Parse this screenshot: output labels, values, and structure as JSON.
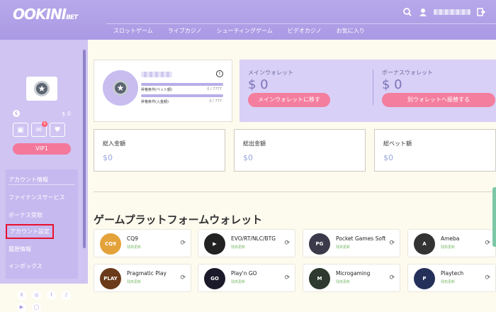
{
  "header": {
    "logo": "OOKINI",
    "logo_sub": "BET",
    "nav": [
      "スロットゲーム",
      "ライブカジノ",
      "シューティングゲーム",
      "ビデオカジノ",
      "お気に入り"
    ]
  },
  "sidebar": {
    "balance": "$ 0",
    "vip": "VIP1",
    "gift_badge": "0",
    "menu_title": "アカウント情報",
    "items": [
      "ファイナンスサービス",
      "ボーナス受取",
      "アカウント設定",
      "履歴情報",
      "インボックス"
    ]
  },
  "profile": {
    "bar1_label": "昇格条件(ベット額)",
    "bar1_value": "0 / 7777",
    "bar2_label": "昇格条件(入金額)",
    "bar2_value": "0 / 777"
  },
  "wallet": {
    "main_label": "メインウォレット",
    "main_value": "$ 0",
    "main_button": "メインウォレットに移す",
    "bonus_label": "ボーナスウォレット",
    "bonus_value": "$ 0",
    "bonus_button": "別ウォレットへ振替する"
  },
  "stats": [
    {
      "label": "総入金額",
      "value": "$0"
    },
    {
      "label": "総出金額",
      "value": "$0"
    },
    {
      "label": "総ベット額",
      "value": "$0"
    }
  ],
  "section_title": "ゲームプラットフォームウォレット",
  "games": [
    {
      "name": "CQ9",
      "status": "残高更新",
      "icon": "CQ9",
      "color": "#e4a23a"
    },
    {
      "name": "EVO/RT/NLC/BTG",
      "status": "残高更新",
      "icon": "▶",
      "color": "#222"
    },
    {
      "name": "Pocket Games Soft",
      "status": "残高更新",
      "icon": "PG",
      "color": "#3a3a4a"
    },
    {
      "name": "Ameba",
      "status": "残高更新",
      "icon": "A",
      "color": "#333"
    },
    {
      "name": "Pragmatic Play",
      "status": "残高更新",
      "icon": "PLAY",
      "color": "#6a3a1a"
    },
    {
      "name": "Play'n GO",
      "status": "残高更新",
      "icon": "GO",
      "color": "#1a1a2a"
    },
    {
      "name": "Microgaming",
      "status": "残高更新",
      "icon": "M",
      "color": "#2d3a2d"
    },
    {
      "name": "Playtech",
      "status": "残高更新",
      "icon": "P",
      "color": "#25305a"
    }
  ]
}
